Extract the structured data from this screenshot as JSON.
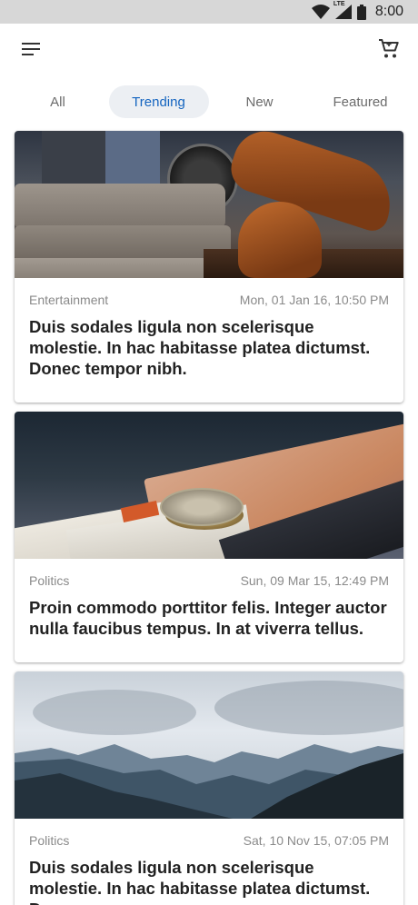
{
  "status_bar": {
    "time": "8:00",
    "network_label": "LTE",
    "icons": [
      "wifi-icon",
      "cellular-signal-icon",
      "battery-icon"
    ]
  },
  "app_bar": {
    "menu_icon": "menu-icon",
    "cart_icon": "cart-icon"
  },
  "tabs": [
    {
      "label": "All",
      "active": false
    },
    {
      "label": "Trending",
      "active": true
    },
    {
      "label": "New",
      "active": false
    },
    {
      "label": "Featured",
      "active": false
    }
  ],
  "colors": {
    "accent": "#1565c0",
    "active_tab_bg": "#eceff3",
    "status_bar_bg": "#d7d7d7"
  },
  "articles": [
    {
      "category": "Entertainment",
      "date": "Mon, 01 Jan 16, 10:50 PM",
      "headline": "Duis sodales ligula non scelerisque molestie. In hac habitasse platea dictumst. Donec tempor nibh."
    },
    {
      "category": "Politics",
      "date": "Sun, 09 Mar 15, 12:49 PM",
      "headline": "Proin commodo porttitor felis. Integer auctor nulla faucibus tempus. In at viverra tellus."
    },
    {
      "category": "Politics",
      "date": "Sat, 10 Nov 15, 07:05 PM",
      "headline": "Duis sodales ligula non scelerisque molestie. In hac habitasse platea dictumst. Donec"
    }
  ]
}
